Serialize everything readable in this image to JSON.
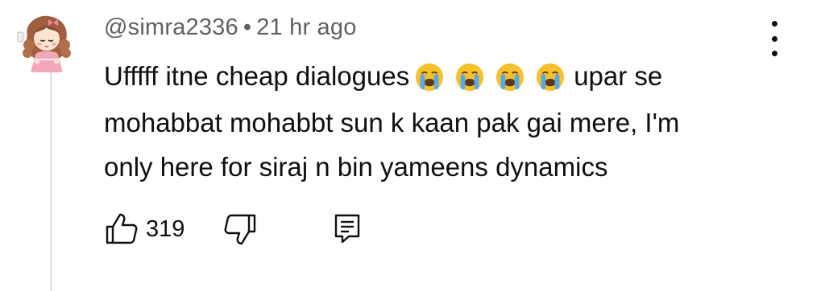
{
  "comment": {
    "username": "@simra2336",
    "separator": "•",
    "time_ago": "21 hr ago",
    "text_lines": {
      "l1_before": "Ufffff itne cheap dialogues",
      "l1_after": "upar se",
      "l2": "mohabbat mohabbt sun k kaan pak gai mere, I'm",
      "l3": "only here for siraj n bin yameens dynamics"
    },
    "emojis": [
      "loudly-crying-face",
      "loudly-crying-face",
      "loudly-crying-face",
      "loudly-crying-face"
    ],
    "like_count": "319",
    "icons": {
      "like": "thumbs-up-icon",
      "dislike": "thumbs-down-icon",
      "reply": "reply-comment-icon",
      "more": "more-vertical-icon"
    }
  },
  "colors": {
    "text": "#0f0f0f",
    "meta": "#606060",
    "thread_line": "#e5e5e5",
    "emoji_yellow": "#f7c12b",
    "emoji_tears": "#5aa8e6"
  }
}
